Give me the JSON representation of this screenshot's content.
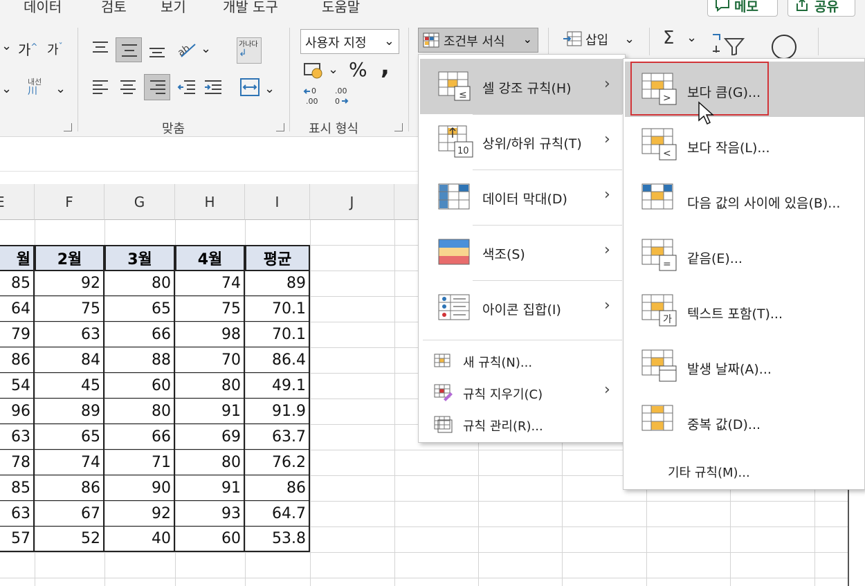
{
  "ribbon": {
    "tabs": [
      "데이터",
      "검토",
      "보기",
      "개발 도구",
      "도움말"
    ],
    "memo_label": "메모",
    "share_label": "공유",
    "font_grow": "가",
    "font_shrink": "가",
    "phonetic": "내선",
    "orient": "가나다",
    "wrap": "가나다",
    "group_align": "맞춤",
    "group_number": "표시 형식",
    "number_format": "사용자 지정",
    "percent": "%",
    "comma": ",",
    "conditional_format": "조건부 서식",
    "insert": "삽입",
    "sigma": "Σ"
  },
  "sheet": {
    "columns": [
      "E",
      "F",
      "G",
      "H",
      "I",
      "J"
    ],
    "headers": [
      "월",
      "2월",
      "3월",
      "4월",
      "평균"
    ],
    "rows": [
      [
        "85",
        "92",
        "80",
        "74",
        "89"
      ],
      [
        "64",
        "75",
        "65",
        "75",
        "70.1"
      ],
      [
        "79",
        "63",
        "66",
        "98",
        "70.1"
      ],
      [
        "86",
        "84",
        "88",
        "70",
        "86.4"
      ],
      [
        "54",
        "45",
        "60",
        "80",
        "49.1"
      ],
      [
        "96",
        "89",
        "80",
        "91",
        "91.9"
      ],
      [
        "63",
        "65",
        "66",
        "69",
        "63.7"
      ],
      [
        "78",
        "74",
        "71",
        "80",
        "76.2"
      ],
      [
        "85",
        "86",
        "90",
        "91",
        "86"
      ],
      [
        "63",
        "67",
        "92",
        "93",
        "64.7"
      ],
      [
        "57",
        "52",
        "40",
        "60",
        "53.8"
      ]
    ]
  },
  "cf_menu": {
    "items": [
      {
        "label": "셀 강조 규칙(H)",
        "icon": "highlight-cells-icon"
      },
      {
        "label": "상위/하위 규칙(T)",
        "icon": "top-bottom-icon"
      },
      {
        "label": "데이터 막대(D)",
        "icon": "data-bars-icon"
      },
      {
        "label": "색조(S)",
        "icon": "color-scales-icon"
      },
      {
        "label": "아이콘 집합(I)",
        "icon": "icon-sets-icon"
      }
    ],
    "small_items": [
      {
        "label": "새 규칙(N)..."
      },
      {
        "label": "규칙 지우기(C)"
      },
      {
        "label": "규칙 관리(R)..."
      }
    ]
  },
  "sub_menu": {
    "items": [
      {
        "label": "보다 큼(G)...",
        "glyph": ">"
      },
      {
        "label": "보다 작음(L)...",
        "glyph": "<"
      },
      {
        "label": "다음 값의 사이에 있음(B)...",
        "glyph": ""
      },
      {
        "label": "같음(E)...",
        "glyph": "="
      },
      {
        "label": "텍스트 포함(T)...",
        "glyph": "가"
      },
      {
        "label": "발생 날짜(A)...",
        "glyph": ""
      },
      {
        "label": "중복 값(D)...",
        "glyph": ""
      }
    ],
    "more": "기타 규칙(M)..."
  },
  "colors": {
    "accent": "#d13438",
    "header_fill": "#dce3ef",
    "orange": "#f4b942",
    "blue": "#2e74b5"
  }
}
